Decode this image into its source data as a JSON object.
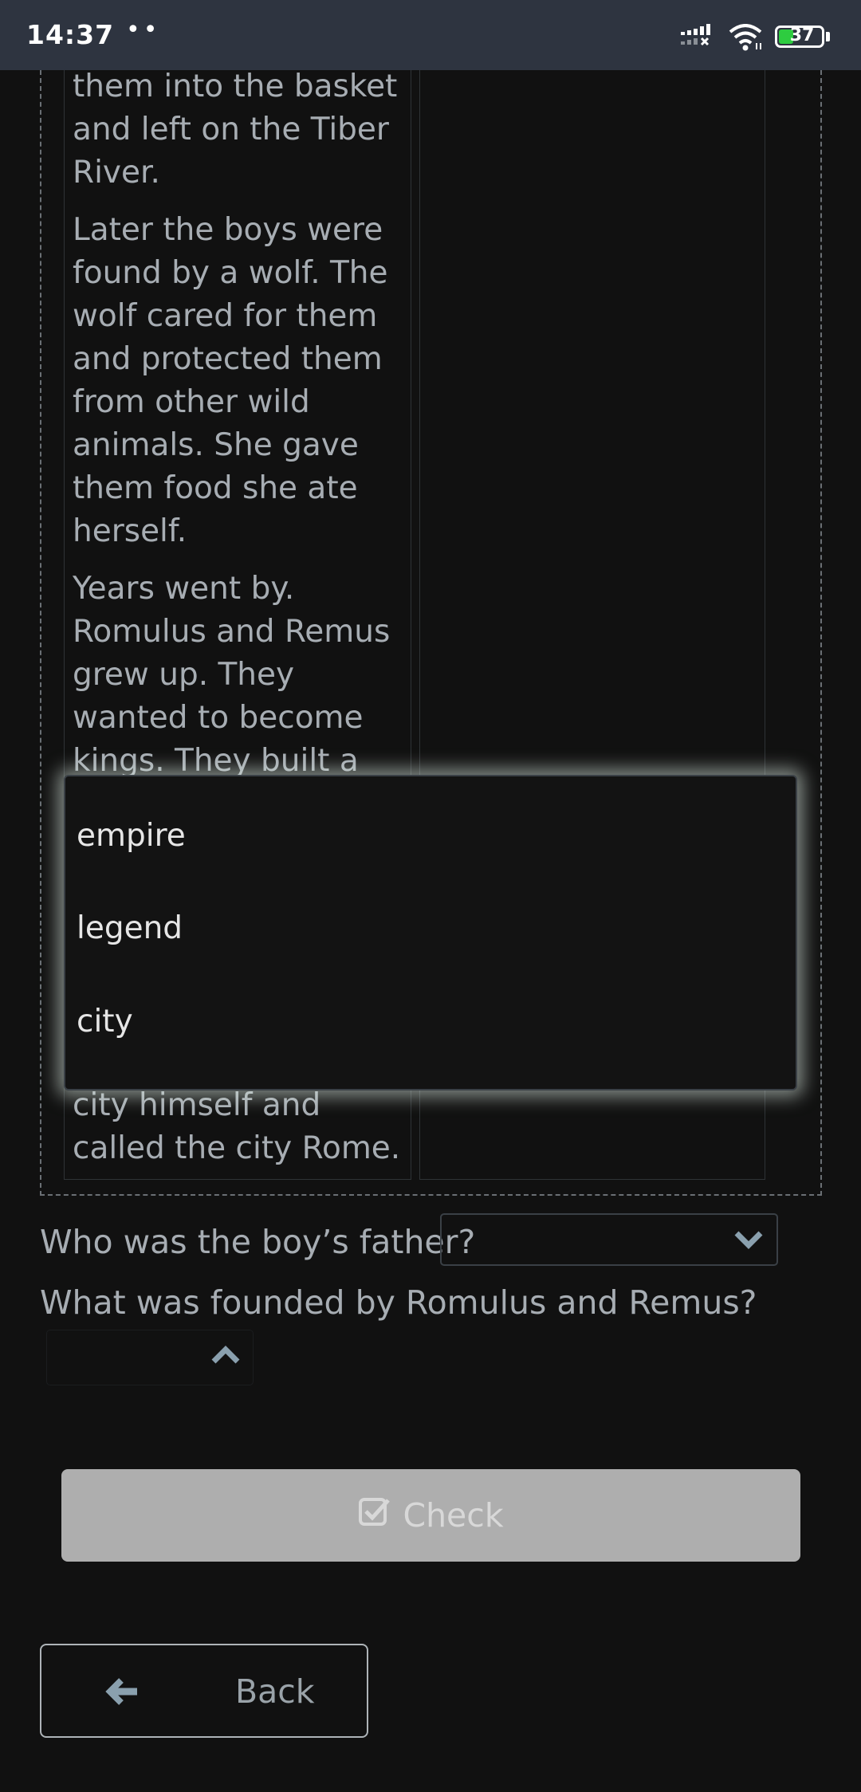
{
  "status_bar": {
    "time": "14:37",
    "dots": "••",
    "battery_level": "37"
  },
  "reading": {
    "paragraphs": [
      "them into the basket and left on the Tiber River.",
      "Later the boys were found by a wolf. The wolf cared for them and protected them from other wild animals. She gave them food she ate herself.",
      "Years went by. Romulus and Remus grew up. They wanted to become kings. They built a city, but they",
      "city himself and called the city Rome."
    ]
  },
  "dropdown": {
    "options": [
      "empire",
      "legend",
      "city"
    ]
  },
  "questions": [
    {
      "text": "Who was the boy’s father?",
      "selected": ""
    },
    {
      "text": "What was founded by Romulus and Remus?",
      "selected": ""
    }
  ],
  "buttons": {
    "check_label": "Check",
    "back_label": "Back"
  },
  "colors": {
    "background": "#111111",
    "status_bar": "#2e3440",
    "check_button": "#aeaeae",
    "chevron": "#8aa0ae"
  }
}
